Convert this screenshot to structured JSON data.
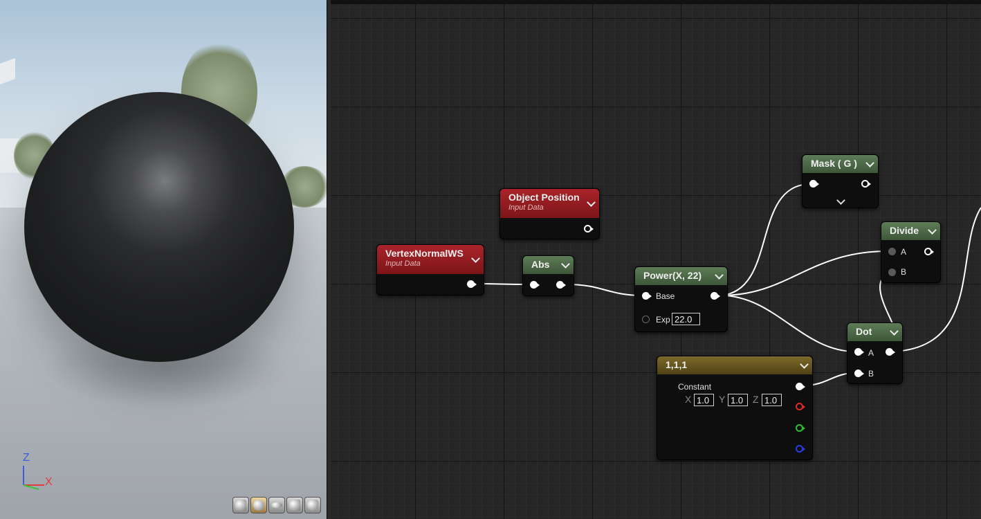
{
  "viewport": {
    "gizmo": {
      "z": "Z",
      "x": "X",
      "colors": {
        "x": "#e23b3b",
        "y": "#39c23a",
        "z": "#3b5ce2"
      }
    },
    "view_modes": [
      "cylinder-icon",
      "sphere-icon",
      "plane-icon",
      "cube-icon",
      "teapot-icon"
    ]
  },
  "nodes": {
    "object_position": {
      "title": "Object Position",
      "subtitle": "Input Data"
    },
    "vertex_normal": {
      "title": "VertexNormalWS",
      "subtitle": "Input Data"
    },
    "abs": {
      "title": "Abs"
    },
    "power": {
      "title": "Power(X, 22)",
      "base_label": "Base",
      "exp_label": "Exp",
      "exp_value": "22.0"
    },
    "mask": {
      "title": "Mask ( G )"
    },
    "divide": {
      "title": "Divide",
      "a_label": "A",
      "b_label": "B"
    },
    "dot": {
      "title": "Dot",
      "a_label": "A",
      "b_label": "B"
    },
    "constant": {
      "title": "1,1,1",
      "label": "Constant",
      "x_label": "X",
      "x_value": "1.0",
      "y_label": "Y",
      "y_value": "1.0",
      "z_label": "Z",
      "z_value": "1.0"
    }
  },
  "colors": {
    "input_header": "#a9242a",
    "math_header": "#5e7d58",
    "constant_header": "#7d6a2a",
    "wire": "#ffffff"
  }
}
